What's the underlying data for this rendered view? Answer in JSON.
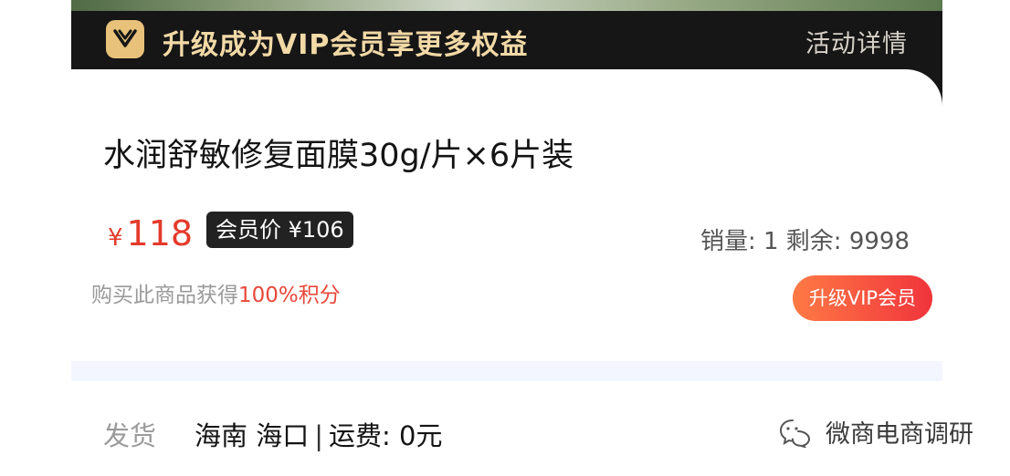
{
  "vip_bar": {
    "text": "升级成为VIP会员享更多权益",
    "activity_link": "活动详情",
    "logo_icon": "vip-heart-badge-icon",
    "gold_color": "#e8c27a"
  },
  "product": {
    "title": "水润舒敏修复面膜30g/片×6片装",
    "currency_symbol": "¥",
    "price": "118",
    "member_price_label": "会员价 ¥106",
    "stats_text": "销量: 1  剩余: 9998",
    "points_prefix": "购买此商品获得",
    "points_highlight": "100%积分",
    "upgrade_button": "升级VIP会员",
    "price_color": "#e43a2a"
  },
  "shipping": {
    "label": "发货",
    "location": "海南 海口",
    "separator": "|",
    "fee": "运费: 0元"
  },
  "watermark": {
    "text": "微商电商调研",
    "icon": "wechat-official-account-icon"
  }
}
